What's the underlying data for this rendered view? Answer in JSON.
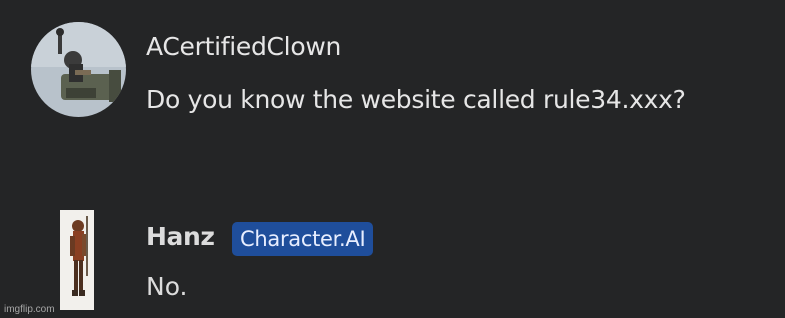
{
  "messages": [
    {
      "author": "ACertifiedClown",
      "text": "Do you know the website called rule34.xxx?",
      "avatar_icon": "user-avatar-icon"
    },
    {
      "author": "Hanz",
      "badge": "Character.AI",
      "text": "No.",
      "avatar_icon": "character-avatar-icon"
    }
  ],
  "watermark": "imgflip.com",
  "colors": {
    "background": "#242526",
    "text": "#e6e6e6",
    "badge": "#1f4e9b"
  }
}
